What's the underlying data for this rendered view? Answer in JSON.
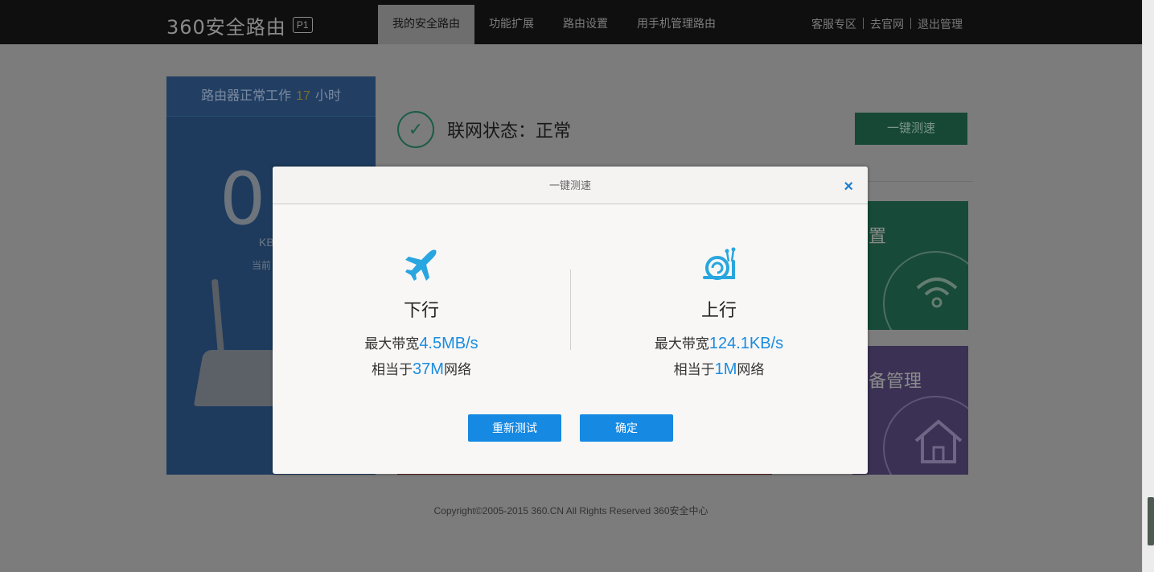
{
  "header": {
    "logo_text": "360安全路由",
    "logo_badge": "P1",
    "nav": [
      "我的安全路由",
      "功能扩展",
      "路由设置",
      "用手机管理路由"
    ],
    "links": [
      "客服专区",
      "去官网",
      "退出管理"
    ]
  },
  "left_panel": {
    "uptime_prefix": "路由器正常工作",
    "uptime_hours": "17",
    "uptime_suffix": "小时",
    "speed_value": "0.",
    "speed_unit": "KB",
    "speed_note": "当前"
  },
  "status": {
    "text": "联网状态：正常",
    "speedtest_button": "一键测速"
  },
  "tiles": {
    "green_label": "置",
    "purple_label": "备管理"
  },
  "footer": "Copyright©2005-2015 360.CN All Rights Reserved 360安全中心",
  "modal": {
    "title": "一键测速",
    "close": "×",
    "download": {
      "title": "下行",
      "bandwidth_prefix": "最大带宽",
      "bandwidth_value": "4.5MB/s",
      "equiv_prefix": "相当于",
      "equiv_value": "37M",
      "equiv_suffix": "网络"
    },
    "upload": {
      "title": "上行",
      "bandwidth_prefix": "最大带宽",
      "bandwidth_value": "124.1KB/s",
      "equiv_prefix": "相当于",
      "equiv_value": "1M",
      "equiv_suffix": "网络"
    },
    "retest_button": "重新测试",
    "ok_button": "确定"
  },
  "colors": {
    "accent": "#1a8ce0",
    "button": "#1689e3"
  }
}
